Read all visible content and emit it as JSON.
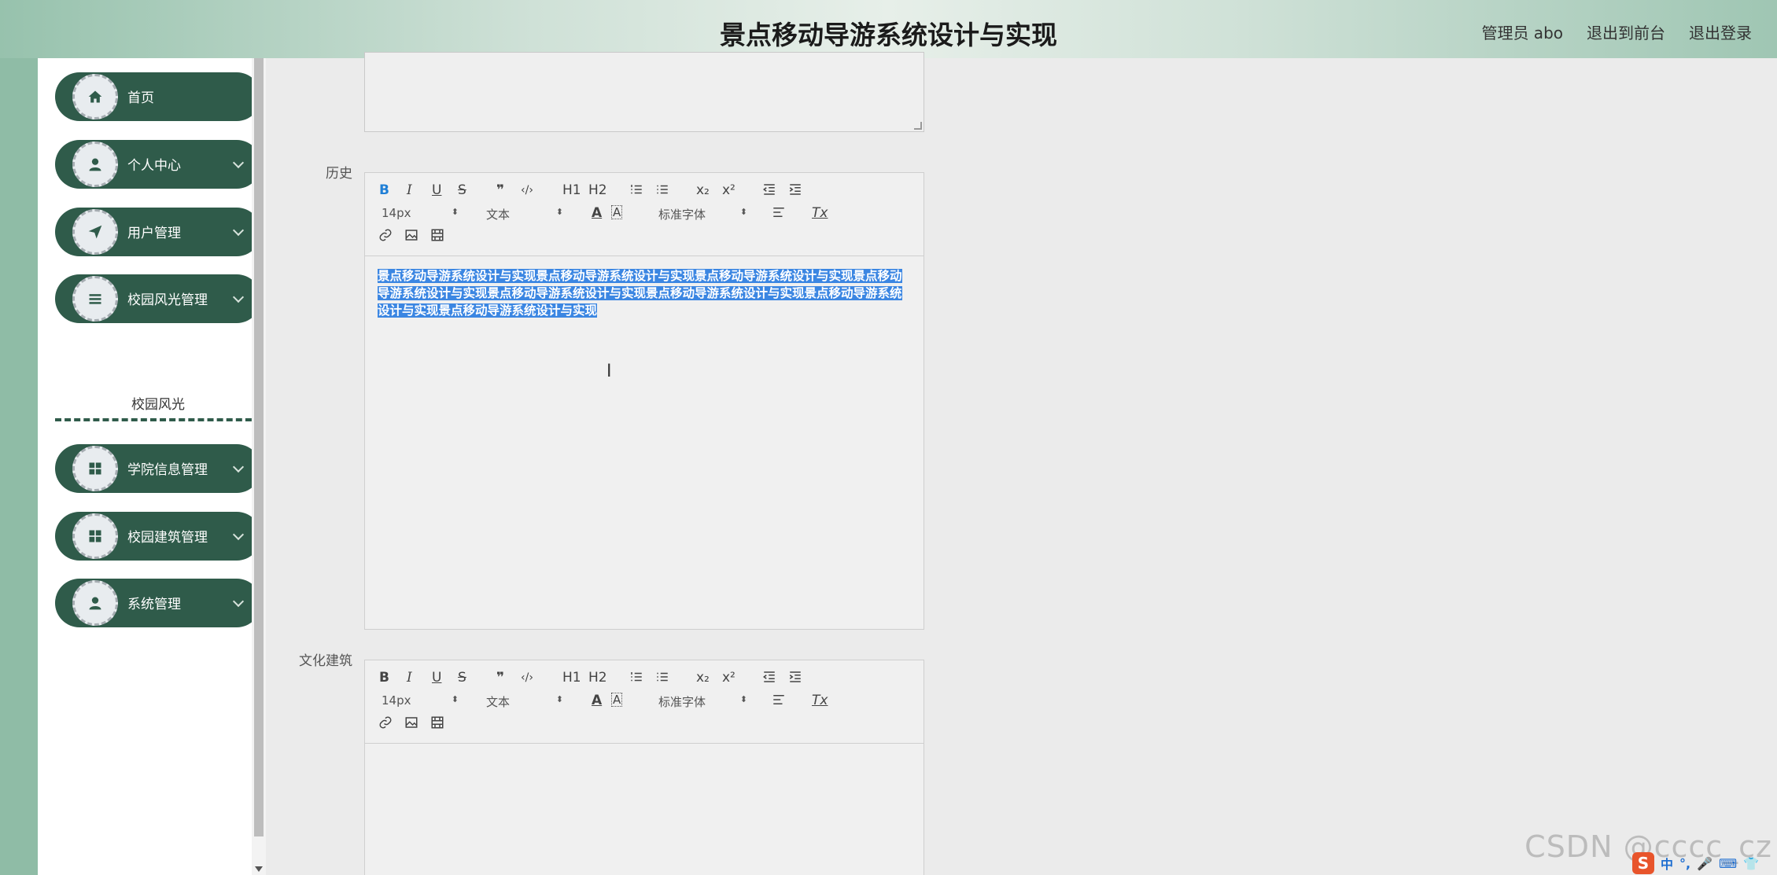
{
  "header": {
    "title": "景点移动导游系统设计与实现",
    "user": "管理员 abo",
    "to_front": "退出到前台",
    "logout": "退出登录"
  },
  "sidebar": {
    "items": [
      {
        "label": "首页",
        "icon": "home-icon",
        "chevron": false
      },
      {
        "label": "个人中心",
        "icon": "user-icon",
        "chevron": true
      },
      {
        "label": "用户管理",
        "icon": "send-icon",
        "chevron": true
      },
      {
        "label": "校园风光管理",
        "icon": "list-icon",
        "chevron": true
      },
      {
        "label": "学院信息管理",
        "icon": "grid-icon",
        "chevron": true
      },
      {
        "label": "校园建筑管理",
        "icon": "grid-icon",
        "chevron": true
      },
      {
        "label": "系统管理",
        "icon": "user-icon",
        "chevron": true
      }
    ],
    "submenu_label": "校园风光"
  },
  "form": {
    "history_label": "历史",
    "culture_label": "文化建筑",
    "history_content": "景点移动导游系统设计与实现景点移动导游系统设计与实现景点移动导游系统设计与实现景点移动导游系统设计与实现景点移动导游系统设计与实现景点移动导游系统设计与实现景点移动导游系统设计与实现景点移动导游系统设计与实现"
  },
  "toolbar": {
    "bold": "B",
    "italic": "I",
    "underline": "U",
    "strike": "S",
    "quote": "❞",
    "code": "‹/›",
    "h1": "H1",
    "h2": "H2",
    "sub": "x₂",
    "sup": "x²",
    "size": "14px",
    "header": "文本",
    "font": "标准字体",
    "clean": "Tx"
  },
  "watermark": "CSDN @cccc_cz",
  "tray": {
    "lang": "中"
  }
}
